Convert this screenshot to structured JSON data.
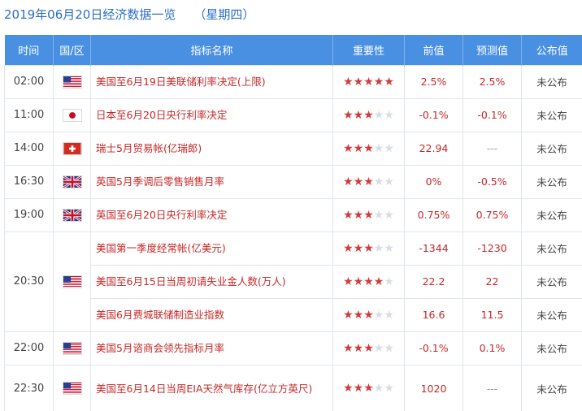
{
  "title": {
    "date": "2019年06月20日经济数据一览",
    "weekday": "（星期四）"
  },
  "headers": [
    "时间",
    "国/区",
    "指标名称",
    "重要性",
    "前值",
    "预测值",
    "公布值"
  ],
  "rows": [
    {
      "time": "02:00",
      "flag": "us-flag-icon",
      "name": "美国至6月19日美联储利率决定(上限)",
      "stars": 5,
      "prev": "2.5%",
      "forecast": "2.5%",
      "actual": "未公布"
    },
    {
      "time": "11:00",
      "flag": "jp-flag-icon",
      "name": "日本至6月20日央行利率决定",
      "stars": 3,
      "prev": "-0.1%",
      "forecast": "-0.1%",
      "actual": "未公布"
    },
    {
      "time": "14:00",
      "flag": "ch-flag-icon",
      "name": "瑞士5月贸易帐(亿瑞郎)",
      "stars": 3,
      "prev": "22.94",
      "forecast": "---",
      "actual": "未公布"
    },
    {
      "time": "16:30",
      "flag": "uk-flag-icon",
      "name": "英国5月季调后零售销售月率",
      "stars": 3,
      "prev": "0%",
      "forecast": "-0.5%",
      "actual": "未公布"
    },
    {
      "time": "19:00",
      "flag": "uk-flag-icon",
      "name": "英国至6月20日央行利率决定",
      "stars": 3,
      "prev": "0.75%",
      "forecast": "0.75%",
      "actual": "未公布"
    },
    {
      "time": "20:30",
      "flag": "us-flag-icon",
      "name": "美国第一季度经常帐(亿美元)",
      "stars": 3,
      "prev": "-1344",
      "forecast": "-1230",
      "actual": "未公布"
    },
    {
      "time": "",
      "flag": "",
      "name": "美国至6月15日当周初请失业金人数(万人)",
      "stars": 4,
      "prev": "22.2",
      "forecast": "22",
      "actual": "未公布"
    },
    {
      "time": "",
      "flag": "",
      "name": "美国6月费城联储制造业指数",
      "stars": 3,
      "prev": "16.6",
      "forecast": "11.5",
      "actual": "未公布"
    },
    {
      "time": "22:00",
      "flag": "us-flag-icon",
      "name": "美国5月谘商会领先指标月率",
      "stars": 3,
      "prev": "-0.1%",
      "forecast": "0.1%",
      "actual": "未公布"
    },
    {
      "time": "22:30",
      "flag": "us-flag-icon",
      "name": "美国至6月14日当周EIA天然气库存(亿立方英尺)",
      "stars": 3,
      "prev": "1020",
      "forecast": "---",
      "actual": "未公布"
    }
  ],
  "colors": {
    "header_bg": "#4a90e2",
    "accent": "#c62828",
    "title": "#2c6ec4"
  }
}
